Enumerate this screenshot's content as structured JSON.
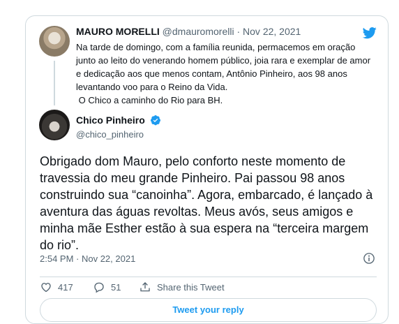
{
  "quoted": {
    "name": "MAURO MORELLI",
    "handle": "@dmauromorelli",
    "separator": "·",
    "date": "Nov 22, 2021",
    "text": "Na tarde de domingo, com a família reunida, permacemos em oração junto ao leito do venerando homem público, joia rara e exemplar de amor e dedicação aos que menos contam, Antônio Pinheiro, aos 98 anos levantando voo para o Reino da Vida.",
    "text2": " O Chico a caminho do Rio para BH."
  },
  "tweet": {
    "name": "Chico Pinheiro",
    "handle": "@chico_pinheiro",
    "text": "Obrigado dom Mauro, pelo conforto neste momento de travessia do meu grande Pinheiro. Pai passou 98 anos construindo sua “canoinha”. Agora, embarcado, é lançado à aventura das águas revoltas. Meus avós, seus amigos e minha mãe Esther estão à sua espera na “terceira margem do rio”.",
    "timestamp": "2:54 PM · Nov 22, 2021"
  },
  "actions": {
    "likes": "417",
    "replies": "51",
    "share_label": "Share this Tweet"
  },
  "reply_button": "Tweet your reply",
  "colors": {
    "accent": "#1d9bf0",
    "muted": "#536471",
    "border": "#cfd9de"
  },
  "icons": [
    "twitter-bird-icon",
    "verified-badge-icon",
    "info-icon",
    "heart-icon",
    "reply-bubble-icon",
    "share-icon"
  ]
}
